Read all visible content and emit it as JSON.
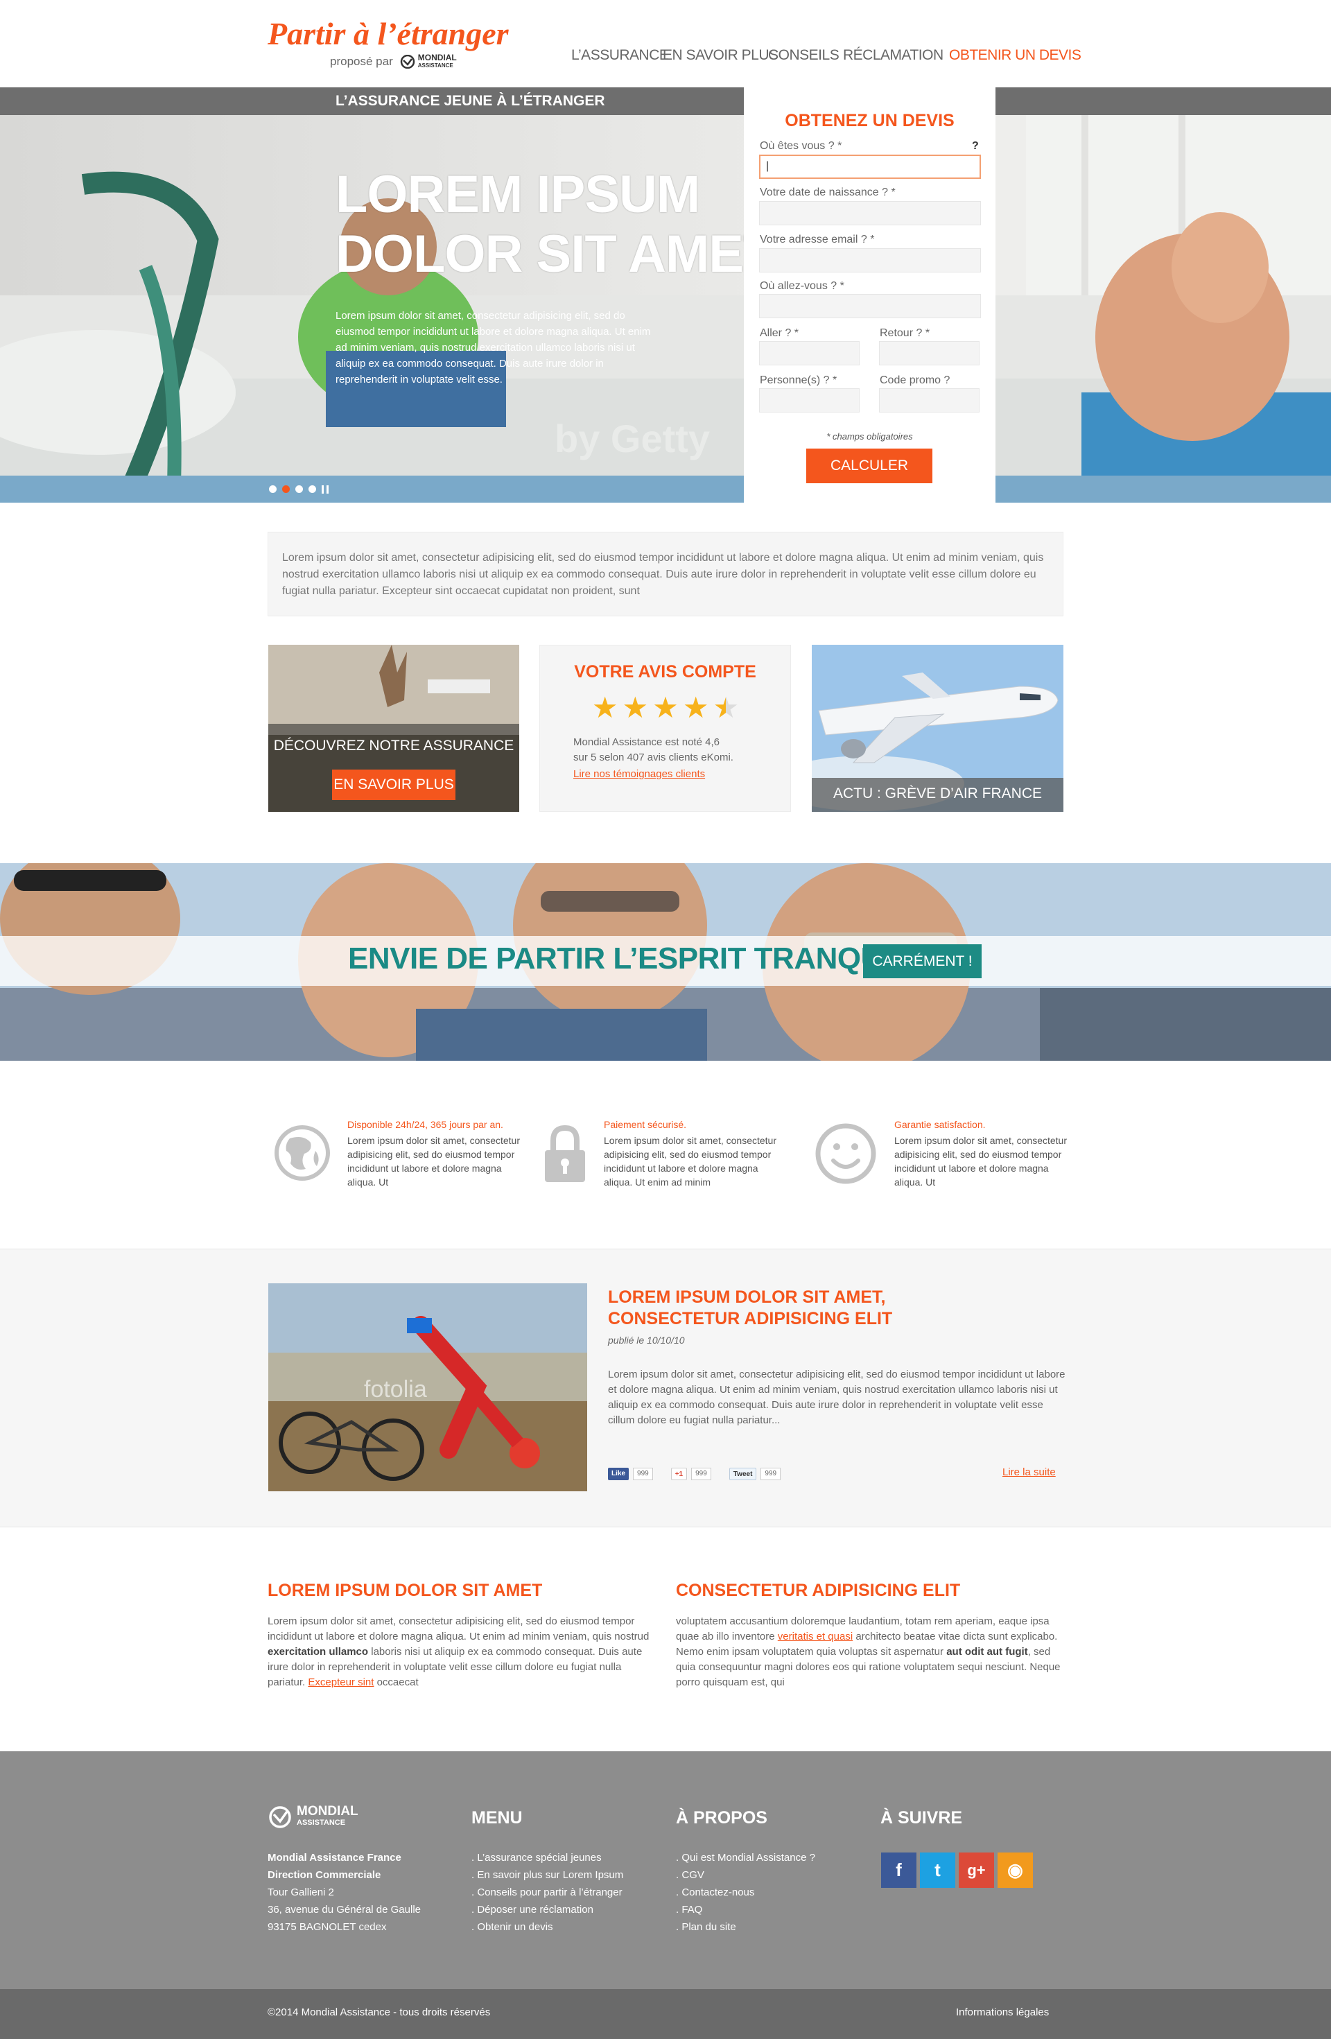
{
  "brand": {
    "site_title": "Partir à l’étranger",
    "proposed_by": "proposé par",
    "partner_line1": "MONDIAL",
    "partner_line2": "ASSISTANCE"
  },
  "nav": {
    "items": [
      {
        "label": "L’ASSURANCE"
      },
      {
        "label": "EN SAVOIR PLUS"
      },
      {
        "label": "CONSEILS"
      },
      {
        "label": "RÉCLAMATION"
      },
      {
        "label": "OBTENIR UN DEVIS"
      }
    ]
  },
  "hero": {
    "band_label": "L’ASSURANCE JEUNE À L’ÉTRANGER",
    "title_line1": "LOREM IPSUM",
    "title_line2": "DOLOR SIT AMET",
    "text": "Lorem ipsum dolor sit amet, consectetur adipisicing elit, sed do eiusmod tempor incididunt ut labore et dolore magna aliqua. Ut enim ad minim veniam, quis nostrud exercitation ullamco laboris nisi ut aliquip ex ea commodo consequat. Duis aute irure dolor in reprehenderit in voluptate velit esse.",
    "watermark": "by Getty",
    "slide_count": 4,
    "active_slide": 1
  },
  "quote_form": {
    "title": "OBTENEZ UN DEVIS",
    "help": "?",
    "fields": {
      "location_label": "Où êtes vous ? *",
      "location_value": "|",
      "birth_label": "Votre date de naissance ? *",
      "email_label": "Votre adresse email ? *",
      "destination_label": "Où allez-vous ? *",
      "depart_label": "Aller ? *",
      "return_label": "Retour ? *",
      "persons_label": "Personne(s) ? *",
      "promo_label": "Code promo ?"
    },
    "required_note": "* champs obligatoires",
    "submit_label": "CALCULER"
  },
  "intro": {
    "text": "Lorem ipsum dolor sit amet, consectetur adipisicing elit, sed do eiusmod tempor incididunt ut labore et dolore magna aliqua. Ut enim ad minim veniam, quis nostrud exercitation ullamco laboris nisi ut aliquip ex ea commodo consequat. Duis aute irure dolor in reprehenderit in voluptate velit esse cillum dolore eu fugiat nulla pariatur. Excepteur sint occaecat cupidatat non proident, sunt"
  },
  "cards": {
    "discover_label": "DÉCOUVREZ NOTRE ASSURANCE",
    "discover_button": "EN SAVOIR PLUS",
    "review_title": "VOTRE AVIS COMPTE",
    "rating": 4.5,
    "rating_max": 5,
    "review_text_line1": "Mondial Assistance est noté 4,6",
    "review_text_line2": "sur 5 selon 407 avis clients eKomi.",
    "review_link": "Lire nos témoignages clients",
    "news_label": "ACTU : GRÈVE D’AIR FRANCE"
  },
  "banner": {
    "title": "ENVIE DE PARTIR L’ESPRIT TRANQUILLE ?",
    "button": "CARRÉMENT !"
  },
  "features": [
    {
      "title": "Disponible 24h/24, 365 jours par an.",
      "text": "Lorem ipsum dolor sit amet, consectetur adipisicing elit, sed do eiusmod tempor incididunt ut labore et dolore magna aliqua. Ut",
      "icon": "globe-icon"
    },
    {
      "title": "Paiement sécurisé.",
      "text": "Lorem ipsum dolor sit amet, consectetur adipisicing elit, sed do eiusmod tempor incididunt ut labore et dolore magna aliqua. Ut enim ad minim",
      "icon": "lock-icon"
    },
    {
      "title": "Garantie satisfaction.",
      "text": "Lorem ipsum dolor sit amet, consectetur adipisicing elit, sed do eiusmod tempor incididunt ut labore et dolore magna aliqua. Ut",
      "icon": "smiley-icon"
    }
  ],
  "article": {
    "title": "LOREM IPSUM DOLOR SIT AMET, CONSECTETUR ADIPISICING ELIT",
    "date": "publié le 10/10/10",
    "text": "Lorem ipsum dolor sit amet, consectetur adipisicing elit, sed do eiusmod tempor incididunt ut labore et dolore magna aliqua. Ut enim ad minim veniam, quis nostrud exercitation ullamco laboris nisi ut aliquip ex ea commodo consequat. Duis aute irure dolor in reprehenderit in voluptate velit esse cillum dolore eu fugiat nulla pariatur...",
    "watermark": "fotolia",
    "like_label": "Like",
    "like_count": "999",
    "gplus_label": "+1",
    "gplus_count": "999",
    "tweet_label": "Tweet",
    "tweet_count": "999",
    "read_more": "Lire la suite"
  },
  "columns": {
    "left_title": "LOREM IPSUM DOLOR SIT AMET",
    "left_text_a": "Lorem ipsum dolor sit amet, consectetur adipisicing elit, sed do eiusmod tempor incididunt ut labore et dolore magna aliqua. Ut enim ad minim veniam, quis nostrud ",
    "left_text_bold": "exercitation ullamco",
    "left_text_b": " laboris nisi ut aliquip ex ea commodo consequat. Duis aute irure dolor in reprehenderit in voluptate velit esse cillum dolore eu fugiat nulla pariatur. ",
    "left_text_link": "Excepteur sint",
    "left_text_c": " occaecat",
    "right_title": "CONSECTETUR ADIPISICING ELIT",
    "right_text_a": "voluptatem accusantium doloremque laudantium, totam rem aperiam, eaque ipsa quae ab illo inventore ",
    "right_text_link": "veritatis et quasi",
    "right_text_b": " architecto beatae vitae dicta sunt explicabo. Nemo enim ipsam voluptatem quia voluptas sit aspernatur ",
    "right_text_bold": "aut odit aut fugit",
    "right_text_c": ", sed quia consequuntur magni dolores eos qui ratione voluptatem sequi nesciunt. Neque porro quisquam est, qui"
  },
  "footer": {
    "logo_line1": "MONDIAL",
    "logo_line2": "ASSISTANCE",
    "company": "Mondial Assistance France",
    "department": "Direction Commerciale",
    "address1": "Tour Gallieni 2",
    "address2": "36, avenue du Général de Gaulle",
    "address3": "93175 BAGNOLET cedex",
    "menu_title": "MENU",
    "menu_items": [
      ". L’assurance spécial jeunes",
      ". En savoir plus sur Lorem Ipsum",
      ". Conseils pour partir à l’étranger",
      ". Déposer une réclamation",
      ". Obtenir un devis"
    ],
    "about_title": "À PROPOS",
    "about_items": [
      ". Qui est Mondial Assistance ?",
      ". CGV",
      ". Contactez-nous",
      ". FAQ",
      ". Plan du site"
    ],
    "follow_title": "À SUIVRE",
    "social": [
      {
        "icon": "facebook-icon",
        "glyph": "f",
        "color": "#3b5998"
      },
      {
        "icon": "twitter-icon",
        "glyph": "t",
        "color": "#1da1e2"
      },
      {
        "icon": "googleplus-icon",
        "glyph": "g+",
        "color": "#dc4a38"
      },
      {
        "icon": "rss-icon",
        "glyph": "◉",
        "color": "#f29a1d"
      }
    ],
    "copyright": "©2014 Mondial Assistance - tous droits réservés",
    "legal": "Informations légales"
  },
  "colors": {
    "accent": "#f4561d",
    "teal": "#1d8b84",
    "footer": "#8d8d8d",
    "footer_bottom": "#6a6a6a"
  }
}
